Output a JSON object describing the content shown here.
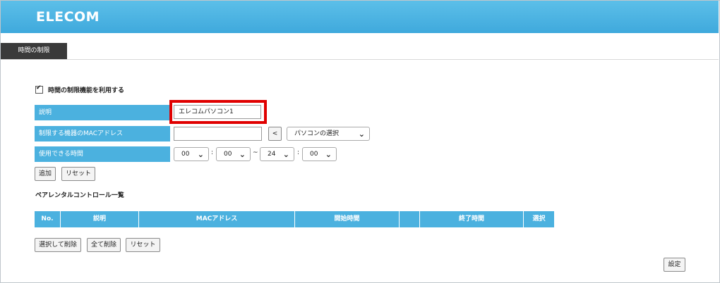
{
  "header": {
    "logo": "ELECOM"
  },
  "tab": {
    "label": "時間の制限"
  },
  "enable": {
    "label": "時間の制限機能を利用する",
    "checked": true
  },
  "form": {
    "description": {
      "label": "説明",
      "value": "エレコムパソコン1"
    },
    "mac": {
      "label": "制限する機器のMACアドレス",
      "value": "",
      "arrow_button": "<",
      "pc_select": "パソコンの選択"
    },
    "time": {
      "label": "使用できる時間",
      "start_hour": "00",
      "start_min": "00",
      "tilde": "~",
      "end_hour": "24",
      "end_min": "00",
      "colon": ":"
    },
    "add_button": "追加",
    "reset_button": "リセット"
  },
  "list": {
    "title": "ペアレンタルコントロール一覧",
    "columns": [
      "No.",
      "説明",
      "MACアドレス",
      "開始時間",
      "",
      "終了時間",
      "選択"
    ]
  },
  "list_actions": {
    "delete_selected": "選択して削除",
    "delete_all": "全て削除",
    "reset": "リセット"
  },
  "submit": "設定",
  "colors": {
    "accent": "#4bb1df",
    "header": "#47b2e2",
    "highlight": "#e00000",
    "tab_bg": "#3a3a3a"
  }
}
